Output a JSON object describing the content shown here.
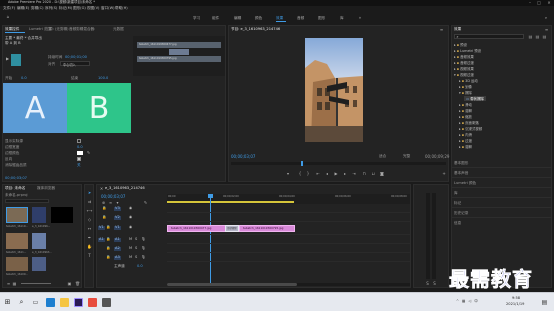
{
  "title_bar": {
    "title": "Adobe Premiere Pro 2020 - D:\\视频\\新建项目\\未命名 *"
  },
  "menu_bar": {
    "items": [
      "文件(F)",
      "编辑(E)",
      "剪辑(C)",
      "序列(S)",
      "标记(M)",
      "图形(G)",
      "视图(V)",
      "窗口(W)",
      "帮助(H)"
    ]
  },
  "workspaces": {
    "items": [
      "学习",
      "组件",
      "编辑",
      "颜色",
      "效果",
      "音频",
      "图形",
      "库"
    ],
    "active": "效果"
  },
  "effect_controls": {
    "tabs": [
      "效果控件",
      "Lumetri 范围",
      "源: (无剪辑)",
      "音频剪辑混合器: ",
      "元数据"
    ],
    "source_label": "主要 * 最终 * 合并导出",
    "effect_name": "带 A 到 B",
    "clip_a": "A",
    "clip_b": "B",
    "prop_duration_label": "持续时间",
    "prop_duration_value": "00;00;01;00",
    "prop_align_label": "对齐",
    "prop_align_value": "中心切入",
    "prop_start_label": "开始",
    "prop_start_value": "0.0",
    "prop_end_label": "结束",
    "prop_end_value": "100.0",
    "rows": [
      {
        "label": "显示实际源",
        "value": ""
      },
      {
        "label": "边框宽度",
        "value": "0.0"
      },
      {
        "label": "边框颜色",
        "value": ""
      },
      {
        "label": "反向",
        "value": ""
      },
      {
        "label": "消除锯齿品质",
        "value": "关"
      }
    ],
    "timecode": "00;00;03;07"
  },
  "program_monitor": {
    "tab": "节目: e_3_1610963_214746",
    "timecode_left": "00;00;03;07",
    "fit_label": "适合",
    "quality_label": "完整",
    "timecode_right": "00;00;09;29"
  },
  "effects_panel": {
    "tab": "效果",
    "search_placeholder": "",
    "items": [
      {
        "label": "预设",
        "indent": 0,
        "open": false
      },
      {
        "label": "Lumetri 预设",
        "indent": 0,
        "open": false
      },
      {
        "label": "音频效果",
        "indent": 0,
        "open": false
      },
      {
        "label": "音频过渡",
        "indent": 0,
        "open": false
      },
      {
        "label": "视频效果",
        "indent": 0,
        "open": false
      },
      {
        "label": "视频过渡",
        "indent": 0,
        "open": true
      },
      {
        "label": "3D 运动",
        "indent": 1,
        "open": false
      },
      {
        "label": "划像",
        "indent": 1,
        "open": false
      },
      {
        "label": "擦除",
        "indent": 1,
        "open": true
      },
      {
        "label": "带状擦除",
        "indent": 2,
        "open": false
      },
      {
        "label": "滑动",
        "indent": 1,
        "open": false
      },
      {
        "label": "溶解",
        "indent": 1,
        "open": false
      },
      {
        "label": "缩放",
        "indent": 1,
        "open": false
      },
      {
        "label": "页面剥落",
        "indent": 1,
        "open": false
      },
      {
        "label": "沉浸式视频",
        "indent": 1,
        "open": false
      },
      {
        "label": "内滑",
        "indent": 1,
        "open": false
      },
      {
        "label": "过渡",
        "indent": 1,
        "open": false
      },
      {
        "label": "溶解",
        "indent": 1,
        "open": false
      }
    ],
    "extra_panels": [
      "基本图形",
      "基本声音",
      "Lumetri 颜色",
      "库",
      "标记",
      "历史记录",
      "信息"
    ]
  },
  "project_panel": {
    "tabs": [
      "项目: 未命名",
      "媒体浏览器"
    ],
    "path": "未命名.prproj",
    "item_count": "",
    "items": [
      {
        "name": "tebatch_16119...",
        "dur": "5;00"
      },
      {
        "name": "e_3_161096...",
        "dur": "9;29"
      },
      {
        "name": "tebatch_1611...",
        "dur": "5;00"
      },
      {
        "name": "e_3_1610963...",
        "dur": "9;29"
      },
      {
        "name": "tebatch_16109...",
        "dur": "5;00"
      },
      {
        "name": "1",
        "dur": ""
      }
    ]
  },
  "timeline": {
    "tab": "e_3_1610963_214746",
    "timecode": "00;00;03;07",
    "ruler": [
      "00;00",
      "00;00;02;00",
      "00;00;04;00",
      "00;00;06;00",
      "00;00;08;00"
    ],
    "tracks": [
      {
        "name": "V3"
      },
      {
        "name": "V2"
      },
      {
        "name": "V1"
      },
      {
        "name": "A1"
      },
      {
        "name": "A2"
      },
      {
        "name": "A3"
      },
      {
        "name": "主声道"
      }
    ],
    "master_value": "0.0",
    "clips": [
      {
        "label": "tebatch_1611019300477.jpg",
        "track": "V1"
      },
      {
        "label": "tebatch_1611019300795.jpg",
        "track": "V1"
      }
    ],
    "transition_label": "带状擦除"
  },
  "source_monitor": {
    "tab_clip_1": "tebatch_1611019300477.jpg",
    "tab_clip_2": "tebatch_1611019300795.jpg"
  },
  "taskbar": {
    "time": "9:58",
    "date": "2021/1/19",
    "search_icon": "search-icon",
    "windows_icon": "windows-icon"
  },
  "watermark": {
    "text": "最需教育"
  },
  "colors": {
    "accent": "#3f9be5",
    "clip": "#d98ad9",
    "clip_a": "#5b9bd5",
    "clip_b": "#2ec58a",
    "watermark": "#2f38c9"
  }
}
